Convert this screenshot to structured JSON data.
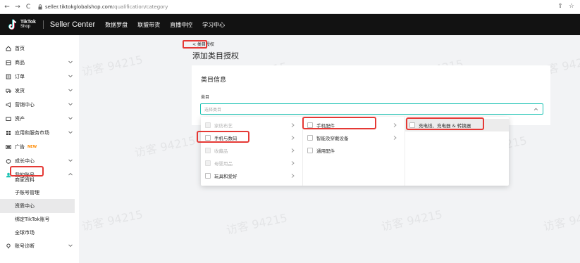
{
  "browser": {
    "url_domain": "seller.tiktokglobalshop.com",
    "url_path": "/qualification/category",
    "nav_back": "←",
    "nav_forward": "→",
    "nav_reload": "C",
    "share": "⇪",
    "star": "☆"
  },
  "header": {
    "logo_line1": "TikTok",
    "logo_line2": "Shop",
    "title": "Seller Center",
    "nav": [
      "数据罗盘",
      "联盟带货",
      "直播中控",
      "学习中心"
    ]
  },
  "sidebar": {
    "items": [
      {
        "label": "首页",
        "icon": "home-icon",
        "chevron": false
      },
      {
        "label": "商品",
        "icon": "product-icon",
        "chevron": true
      },
      {
        "label": "订单",
        "icon": "order-icon",
        "chevron": true
      },
      {
        "label": "发货",
        "icon": "truck-icon",
        "chevron": true
      },
      {
        "label": "营销中心",
        "icon": "megaphone-icon",
        "chevron": true
      },
      {
        "label": "资产",
        "icon": "wallet-icon",
        "chevron": true
      },
      {
        "label": "应用和服务市场",
        "icon": "apps-icon",
        "chevron": true
      },
      {
        "label": "广告",
        "icon": "ads-icon",
        "chevron": false,
        "badge": "NEW"
      },
      {
        "label": "成长中心",
        "icon": "growth-icon",
        "chevron": true
      },
      {
        "label": "我的账号",
        "icon": "account-icon",
        "chevron": "up"
      }
    ],
    "sub_items": [
      "商家资料",
      "子账号管理",
      "资质中心",
      "绑定TikTok账号",
      "全球市场"
    ],
    "last_item": {
      "label": "账号诊断",
      "icon": "diagnosis-icon"
    }
  },
  "main": {
    "back_label": "< 类目授权",
    "page_title": "添加类目授权",
    "card_title": "类目信息",
    "field_label": "类目",
    "select_placeholder": "选择类目"
  },
  "cascader": {
    "col1": [
      {
        "label": "家纺布艺",
        "disabled": true,
        "arrow": true
      },
      {
        "label": "手机与数码",
        "disabled": false,
        "arrow": true
      },
      {
        "label": "收藏品",
        "disabled": true,
        "arrow": true
      },
      {
        "label": "母婴用品",
        "disabled": true,
        "arrow": true
      },
      {
        "label": "玩具和爱好",
        "disabled": false,
        "arrow": true
      }
    ],
    "col2": [
      {
        "label": "手机配件",
        "arrow": true
      },
      {
        "label": "智能及穿戴设备",
        "arrow": true
      },
      {
        "label": "通用配件",
        "arrow": false
      }
    ],
    "col3": [
      {
        "label": "充电线、充电器 & 转换器"
      }
    ]
  },
  "watermark": "访客 94215",
  "colors": {
    "header_bg": "#121212",
    "accent": "#1ec3b4",
    "highlight_circle": "#e53935",
    "new_badge": "#ff8a00"
  }
}
